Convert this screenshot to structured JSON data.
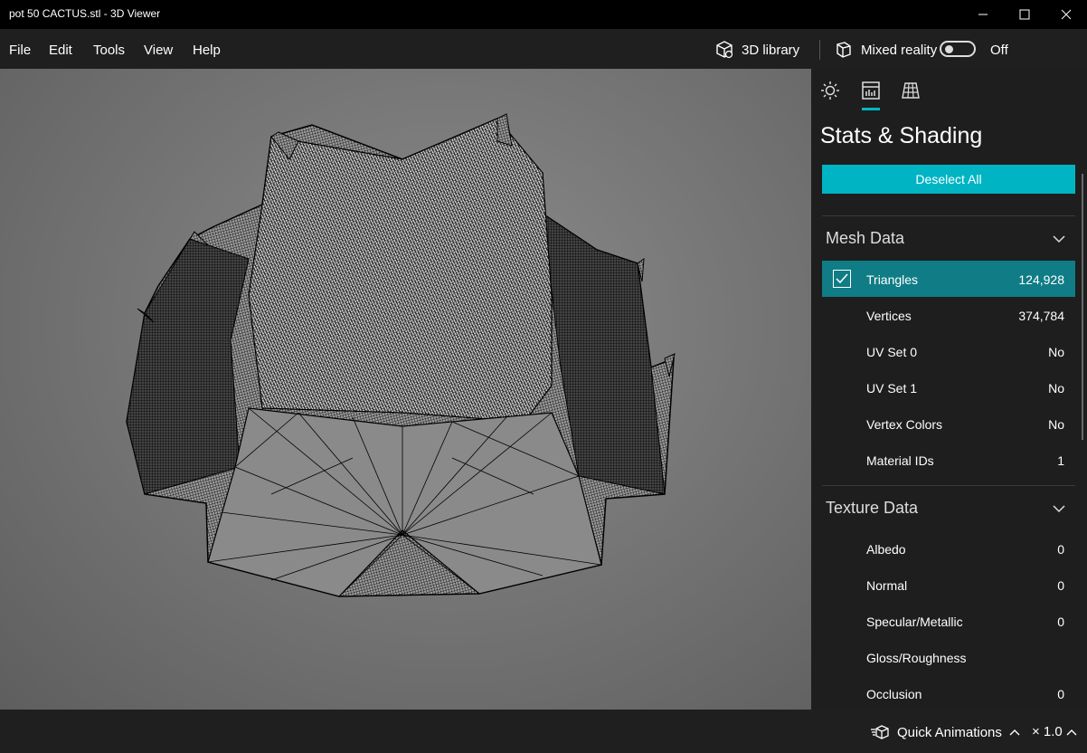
{
  "window": {
    "title": "pot 50 CACTUS.stl - 3D Viewer"
  },
  "menu": {
    "file": "File",
    "edit": "Edit",
    "tools": "Tools",
    "view": "View",
    "help": "Help",
    "library": "3D library",
    "mixed_reality": "Mixed reality",
    "mixed_reality_state": "Off"
  },
  "panel": {
    "title": "Stats & Shading",
    "deselect": "Deselect All",
    "mesh_section": "Mesh Data",
    "mesh_rows": [
      {
        "label": "Triangles",
        "value": "124,928",
        "selected": true
      },
      {
        "label": "Vertices",
        "value": "374,784"
      },
      {
        "label": "UV Set 0",
        "value": "No"
      },
      {
        "label": "UV Set 1",
        "value": "No"
      },
      {
        "label": "Vertex Colors",
        "value": "No"
      },
      {
        "label": "Material IDs",
        "value": "1"
      }
    ],
    "texture_section": "Texture Data",
    "texture_rows": [
      {
        "label": "Albedo",
        "value": "0"
      },
      {
        "label": "Normal",
        "value": "0"
      },
      {
        "label": "Specular/Metallic",
        "value": "0"
      },
      {
        "label": "Gloss/Roughness",
        "value": ""
      },
      {
        "label": "Occlusion",
        "value": "0"
      }
    ]
  },
  "status": {
    "quick_animations": "Quick Animations",
    "speed": "× 1.0"
  },
  "colors": {
    "accent": "#00b4c4",
    "selected_row": "#107c85"
  }
}
